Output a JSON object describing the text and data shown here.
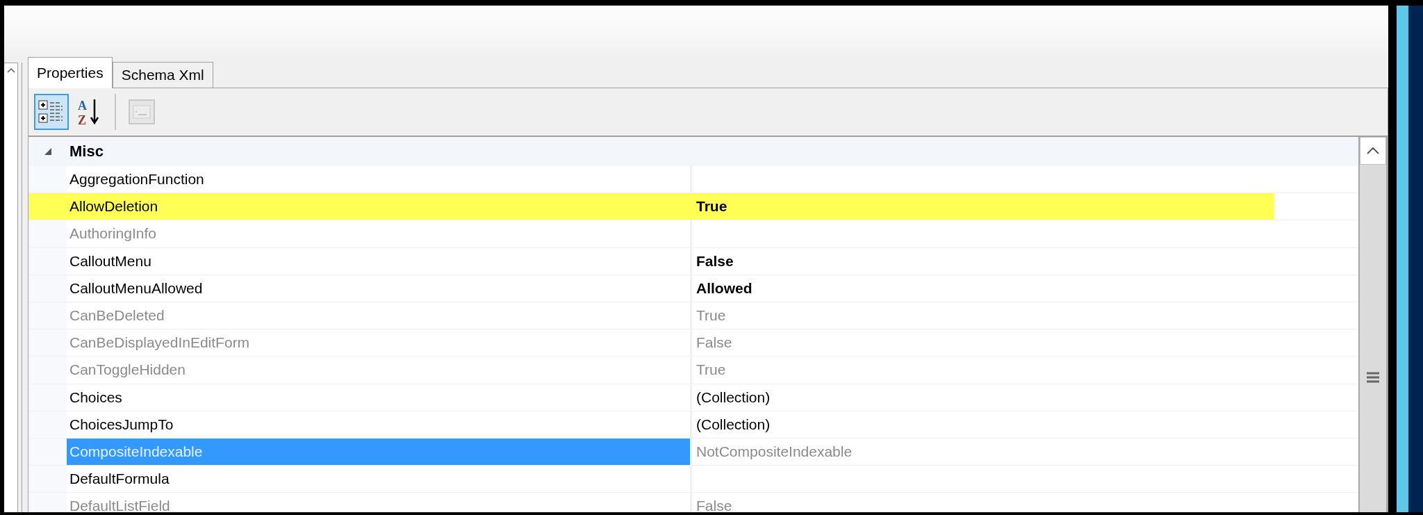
{
  "tabs": [
    {
      "label": "Properties",
      "selected": true
    },
    {
      "label": "Schema Xml",
      "selected": false
    }
  ],
  "toolbar": [
    {
      "kind": "categorized",
      "selected": true,
      "disabled": false
    },
    {
      "kind": "alphabetical",
      "selected": false,
      "disabled": false,
      "letters": [
        "A",
        "Z"
      ]
    },
    {
      "kind": "property-pages",
      "selected": false,
      "disabled": true
    }
  ],
  "category": {
    "label": "Misc",
    "expanded": true
  },
  "rows": [
    {
      "name": "AggregationFunction",
      "readonly": false,
      "highlighted": false,
      "selected": false
    },
    {
      "name": "AllowDeletion",
      "value": "True",
      "readonly": false,
      "modified": true,
      "highlighted": true,
      "selected": false
    },
    {
      "name": "AuthoringInfo",
      "readonly": true,
      "highlighted": false,
      "selected": false
    },
    {
      "name": "CalloutMenu",
      "value": "False",
      "readonly": false,
      "modified": true,
      "highlighted": false,
      "selected": false
    },
    {
      "name": "CalloutMenuAllowed",
      "value": "Allowed",
      "readonly": false,
      "modified": true,
      "highlighted": false,
      "selected": false
    },
    {
      "name": "CanBeDeleted",
      "value": "True",
      "readonly": true,
      "modified": false,
      "highlighted": false,
      "selected": false
    },
    {
      "name": "CanBeDisplayedInEditForm",
      "value": "False",
      "readonly": true,
      "modified": false,
      "highlighted": false,
      "selected": false
    },
    {
      "name": "CanToggleHidden",
      "value": "True",
      "readonly": true,
      "modified": false,
      "highlighted": false,
      "selected": false
    },
    {
      "name": "Choices",
      "value": "(Collection)",
      "readonly": false,
      "modified": false,
      "highlighted": false,
      "selected": false
    },
    {
      "name": "ChoicesJumpTo",
      "value": "(Collection)",
      "readonly": false,
      "modified": false,
      "highlighted": false,
      "selected": false
    },
    {
      "name": "CompositeIndexable",
      "value": "NotCompositeIndexable",
      "readonly": true,
      "modified": false,
      "highlighted": false,
      "selected": true
    },
    {
      "name": "DefaultFormula",
      "readonly": false,
      "highlighted": false,
      "selected": false
    },
    {
      "name": "DefaultListField",
      "value": "False",
      "readonly": true,
      "modified": false,
      "highlighted": false,
      "selected": false
    }
  ]
}
